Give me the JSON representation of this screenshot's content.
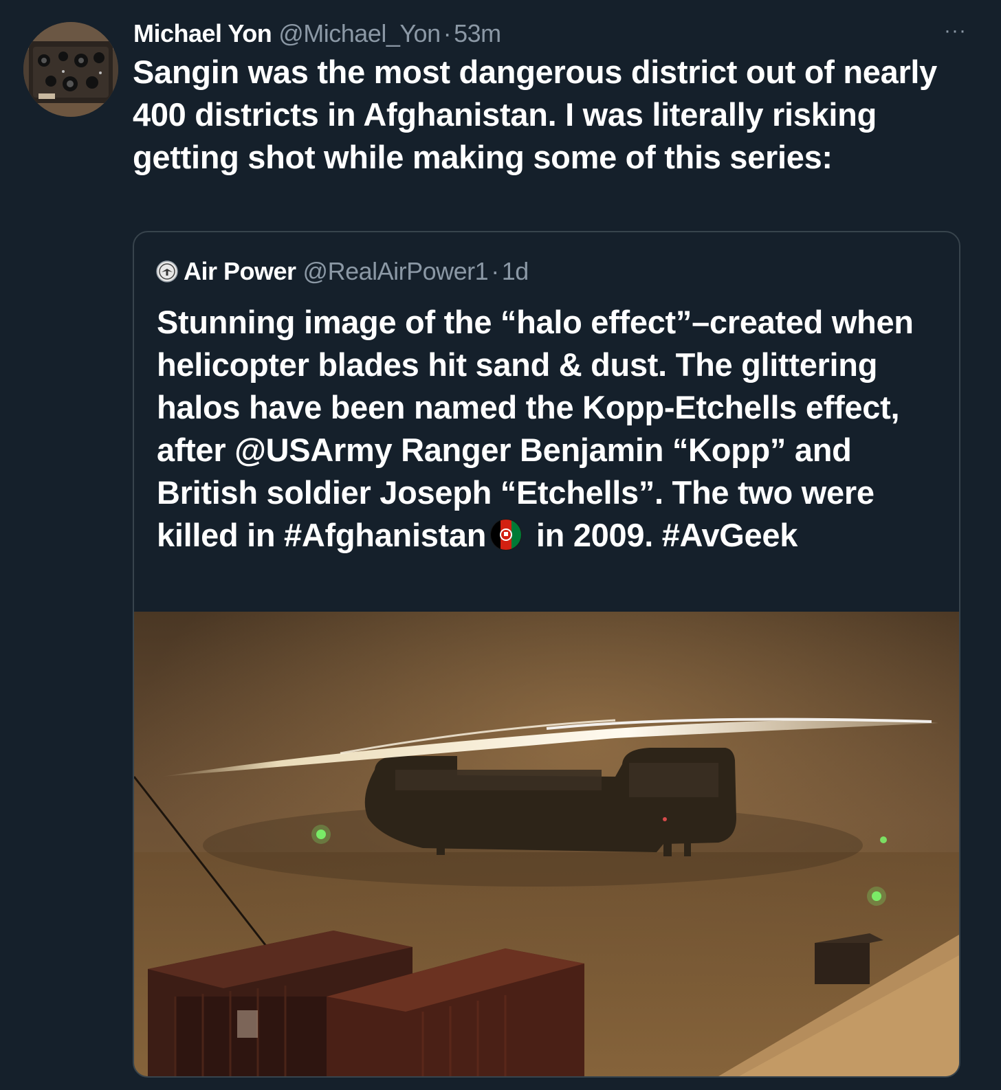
{
  "tweet": {
    "author_name": "Michael Yon",
    "handle": "@Michael_Yon",
    "separator": "·",
    "time": "53m",
    "more": "···",
    "text": "Sangin was the most dangerous district out of nearly 400 districts in Afghanistan.  I was literally risking getting shot while making some of this series:"
  },
  "quote": {
    "author_name": "Air Power",
    "handle": "@RealAirPower1",
    "separator": "·",
    "time": "1d",
    "text_part1": "Stunning image of the “halo effect”–created when helicopter blades hit sand & dust. The glittering halos have been named the Kopp-Etchells effect, after @USArmy Ranger Benjamin “Kopp” and British soldier Joseph “Etchells”. The two were killed in #Afghanistan",
    "text_part2": " in 2009. #AvGeek",
    "emoji": "afghanistan-flag-icon"
  },
  "colors": {
    "background": "#15202b",
    "border": "#38444d",
    "secondary_text": "#8b98a5",
    "primary_text": "#ffffff"
  }
}
